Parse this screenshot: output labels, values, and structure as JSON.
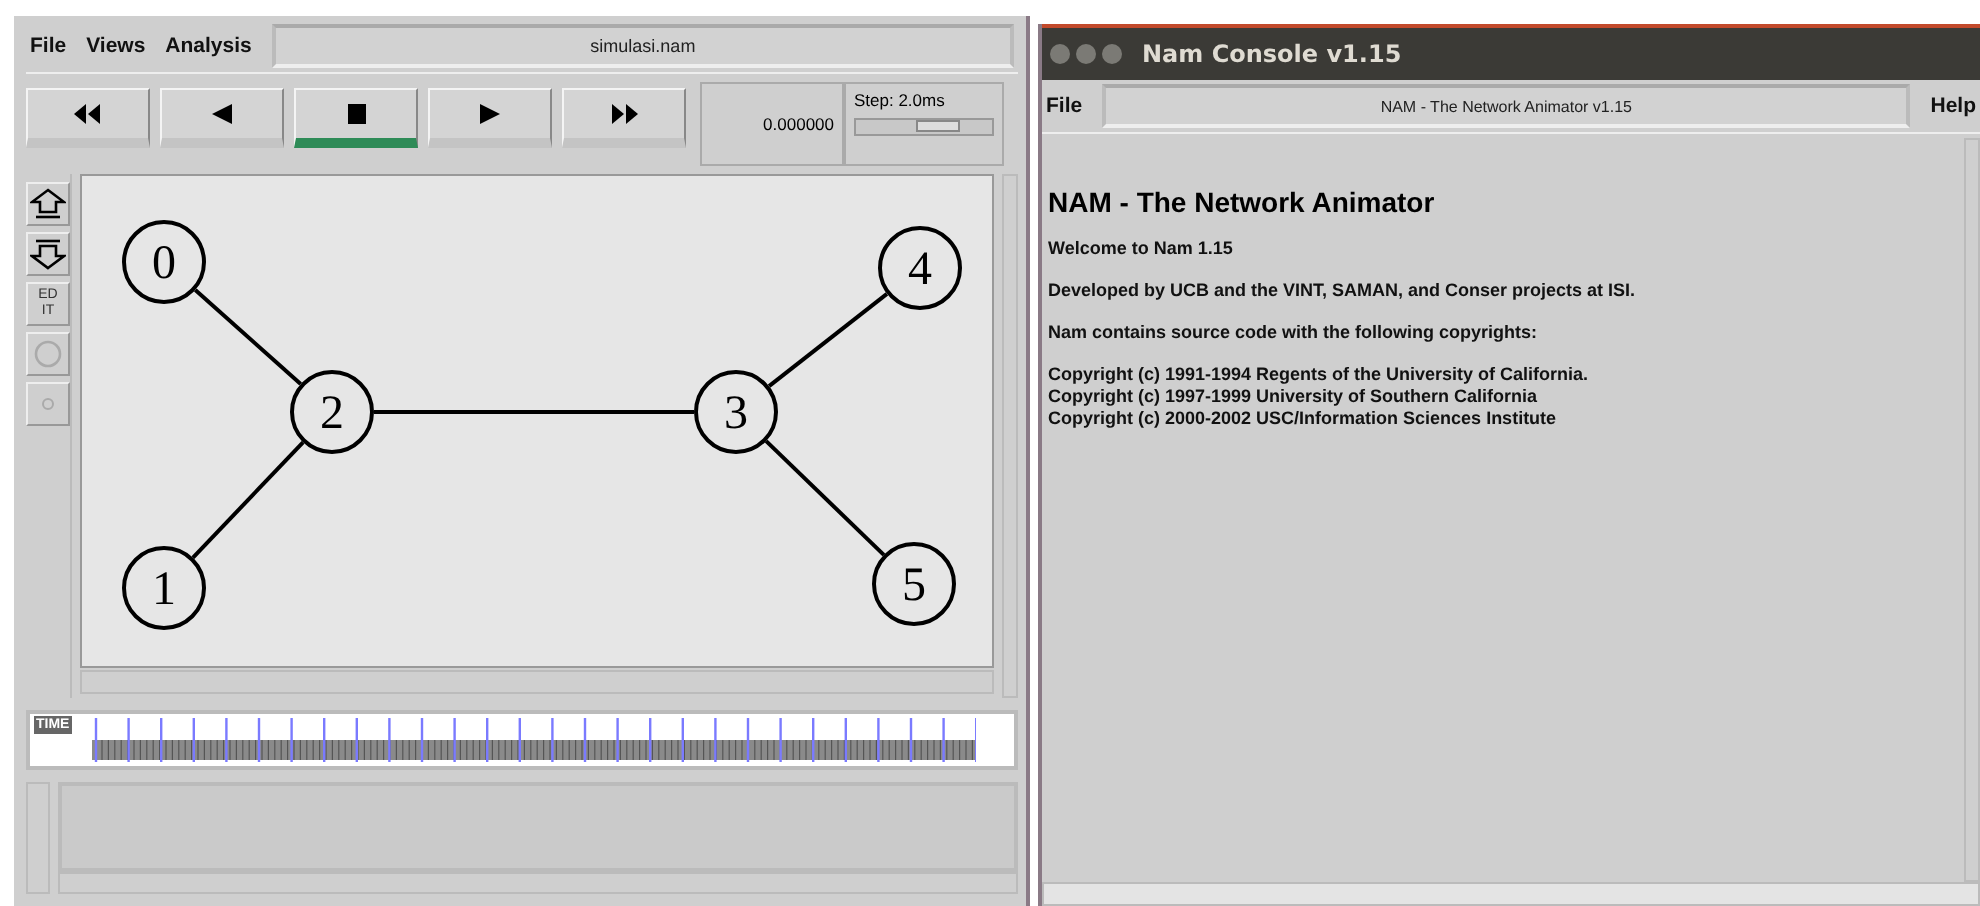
{
  "nam_window": {
    "menus": [
      "File",
      "Views",
      "Analysis"
    ],
    "title": "simulasi.nam",
    "playback": [
      {
        "kind": "rewind",
        "selected": false
      },
      {
        "kind": "back",
        "selected": false
      },
      {
        "kind": "stop",
        "selected": true
      },
      {
        "kind": "play",
        "selected": false
      },
      {
        "kind": "forward",
        "selected": false
      }
    ],
    "time": "0.000000",
    "step_label": "Step: 2.0ms",
    "step_slider": {
      "level": 0.6
    },
    "tools": [
      {
        "kind": "zoom-in"
      },
      {
        "kind": "zoom-out"
      },
      {
        "kind": "edit",
        "label": "ED IT"
      },
      {
        "kind": "circle"
      },
      {
        "kind": "dot"
      }
    ],
    "nodes": [
      "0",
      "1",
      "2",
      "3",
      "4",
      "5"
    ],
    "timeline_label": "TIME"
  },
  "console_window": {
    "title": "Nam Console v1.15",
    "menus": [
      "File",
      "Help"
    ],
    "header": "NAM - The Network Animator v1.15",
    "heading": "NAM - The Network Animator",
    "paragraphs": [
      [
        "Welcome to Nam 1.15"
      ],
      [
        "Developed by UCB and the VINT, SAMAN, and Conser projects at ISI."
      ],
      [
        "Nam contains source code with the following copyrights:"
      ],
      [
        "Copyright (c) 1991-1994 Regents of the University of California.",
        "Copyright (c) 1997-1999 University of Southern California",
        "Copyright (c) 2000-2002 USC/Information Sciences Institute"
      ]
    ]
  }
}
